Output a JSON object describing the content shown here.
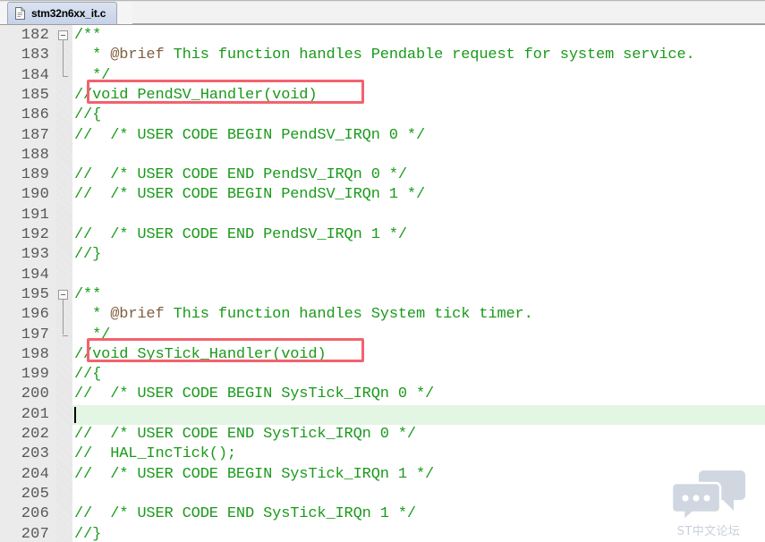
{
  "window": {
    "tab": {
      "label": "stm32n6xx_it.c",
      "icon": "document-icon",
      "active": true
    }
  },
  "editor": {
    "language": "c",
    "comment_color": "#1a9a1a",
    "doc_tag_color": "#7f5f3f",
    "current_line": 201,
    "current_line_highlight_color": "#e3f5e3",
    "gutter_background": "#ebebeb",
    "first_visible_line": 182,
    "last_visible_line": 207,
    "lines": [
      {
        "n": "182",
        "text": "/**",
        "fold": "start"
      },
      {
        "n": "183",
        "text": "  * @brief This function handles Pendable request for system service.",
        "tag": "@brief"
      },
      {
        "n": "184",
        "text": "  */",
        "fold": "end"
      },
      {
        "n": "185",
        "text": "//void PendSV_Handler(void)"
      },
      {
        "n": "186",
        "text": "//{"
      },
      {
        "n": "187",
        "text": "//  /* USER CODE BEGIN PendSV_IRQn 0 */"
      },
      {
        "n": "188",
        "text": ""
      },
      {
        "n": "189",
        "text": "//  /* USER CODE END PendSV_IRQn 0 */"
      },
      {
        "n": "190",
        "text": "//  /* USER CODE BEGIN PendSV_IRQn 1 */"
      },
      {
        "n": "191",
        "text": ""
      },
      {
        "n": "192",
        "text": "//  /* USER CODE END PendSV_IRQn 1 */"
      },
      {
        "n": "193",
        "text": "//}"
      },
      {
        "n": "194",
        "text": ""
      },
      {
        "n": "195",
        "text": "/**",
        "fold": "start"
      },
      {
        "n": "196",
        "text": "  * @brief This function handles System tick timer.",
        "tag": "@brief"
      },
      {
        "n": "197",
        "text": "  */",
        "fold": "end"
      },
      {
        "n": "198",
        "text": "//void SysTick_Handler(void)"
      },
      {
        "n": "199",
        "text": "//{"
      },
      {
        "n": "200",
        "text": "//  /* USER CODE BEGIN SysTick_IRQn 0 */"
      },
      {
        "n": "201",
        "text": "",
        "current": true
      },
      {
        "n": "202",
        "text": "//  /* USER CODE END SysTick_IRQn 0 */"
      },
      {
        "n": "203",
        "text": "//  HAL_IncTick();"
      },
      {
        "n": "204",
        "text": "//  /* USER CODE BEGIN SysTick_IRQn 1 */"
      },
      {
        "n": "205",
        "text": ""
      },
      {
        "n": "206",
        "text": "//  /* USER CODE END SysTick_IRQn 1 */"
      },
      {
        "n": "207",
        "text": "//}"
      }
    ]
  },
  "annotations": {
    "color": "#f2626d",
    "boxes": [
      {
        "id": "pendsv-handler-box",
        "label": "void PendSV_Handler(void)",
        "line": "185"
      },
      {
        "id": "systick-handler-box",
        "label": "void SysTick_Handler(void)",
        "line": "198"
      }
    ]
  },
  "watermark": {
    "text": "ST中文论坛",
    "icon": "chat-bubbles-icon",
    "color": "#aab4c6"
  }
}
